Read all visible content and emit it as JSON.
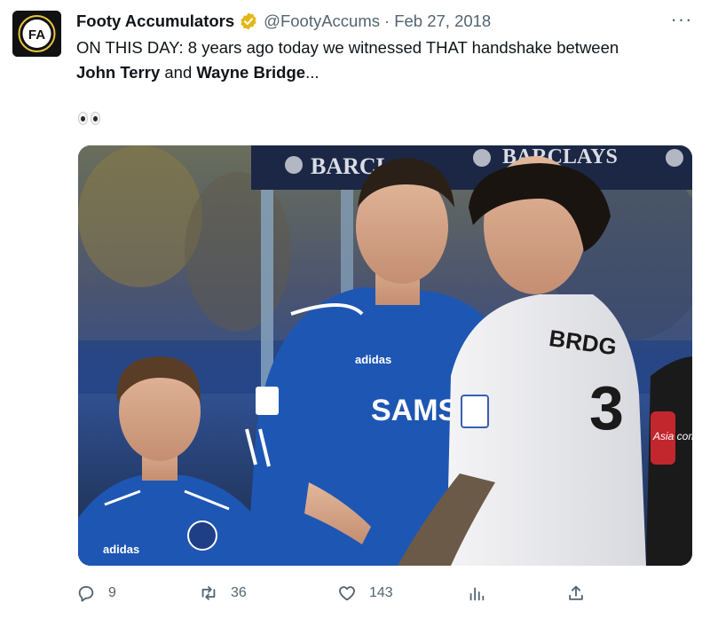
{
  "tweet": {
    "author": {
      "display_name": "Footy Accumulators",
      "handle": "@FootyAccums",
      "verified": true,
      "avatar_label": "FA"
    },
    "separator": "·",
    "date": "Feb 27, 2018",
    "more_label": "···",
    "text": {
      "line1": "ON THIS DAY: 8 years ago today we witnessed THAT handshake between",
      "name1": "John Terry",
      "joiner": "and",
      "name2": "Wayne Bridge",
      "ellipsis": "...",
      "emoji_name": "eyes-emoji"
    },
    "media": {
      "banner_text_left": "BARCL",
      "banner_text_right": "BARCLAYS",
      "shirt_sponsor": "SAMS",
      "shirt_brand": "adidas",
      "away_shirt_name": "BRDG",
      "away_shirt_number": "3",
      "kid_shirt_brand": "adidas",
      "sleeve_badge_text": "Asia com"
    },
    "actions": {
      "reply_count": "9",
      "retweet_count": "36",
      "like_count": "143",
      "views_count": "",
      "share_count": ""
    },
    "colors": {
      "text_primary": "#0f1419",
      "text_secondary": "#536471",
      "verified_gold": "#e2b719",
      "chelsea_blue": "#1e56b4"
    }
  }
}
